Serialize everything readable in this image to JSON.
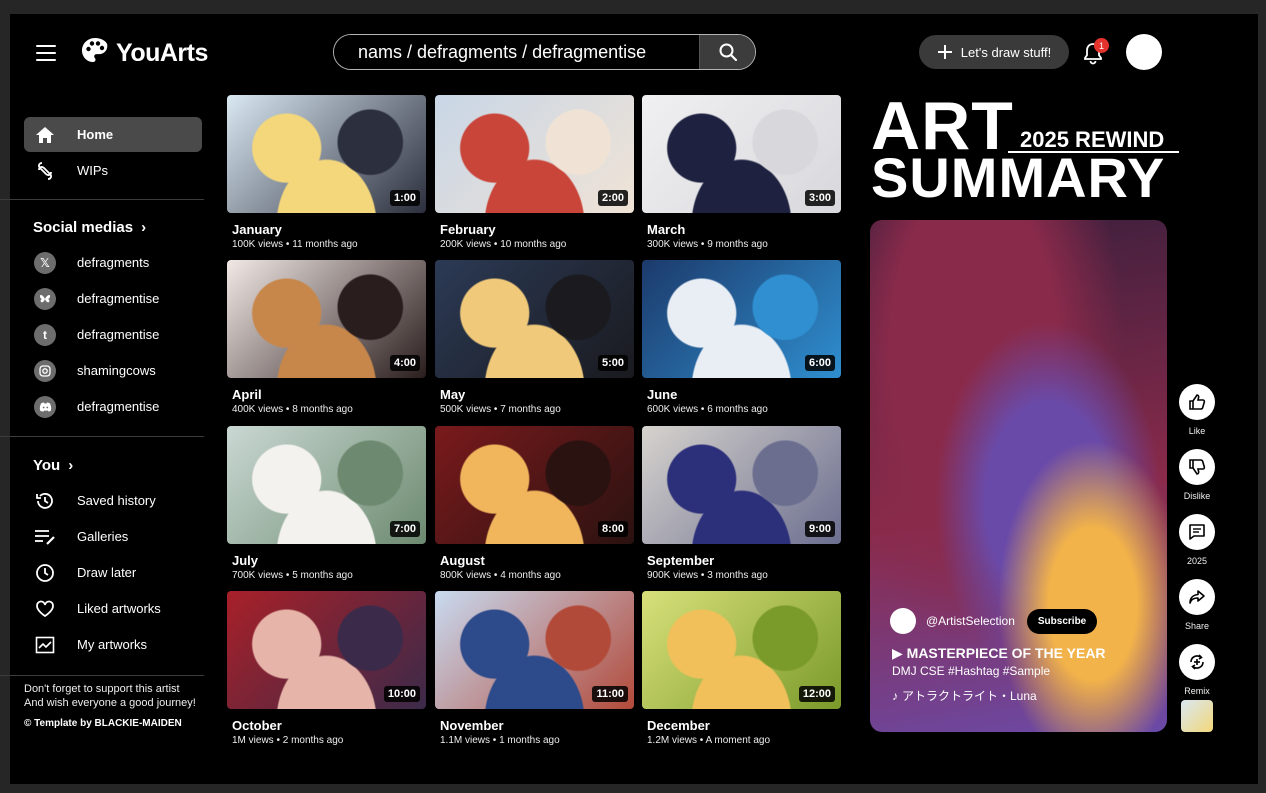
{
  "app": {
    "logo_text": "YouArts"
  },
  "search": {
    "value": "nams / defragments / defragmentise"
  },
  "header": {
    "draw_button_label": "Let's draw stuff!",
    "notification_count": "1"
  },
  "sidebar": {
    "main_items": [
      {
        "label": "Home",
        "icon": "home-icon",
        "active": true
      },
      {
        "label": "WIPs",
        "icon": "wips-icon",
        "active": false
      }
    ],
    "social_title": "Social medias",
    "socials": [
      {
        "label": "defragments",
        "icon": "x-icon"
      },
      {
        "label": "defragmentise",
        "icon": "bluesky-icon"
      },
      {
        "label": "defragmentise",
        "icon": "tumblr-icon"
      },
      {
        "label": "shamingcows",
        "icon": "instagram-icon"
      },
      {
        "label": "defragmentise",
        "icon": "discord-icon"
      }
    ],
    "you_title": "You",
    "you_items": [
      {
        "label": "Saved history",
        "icon": "history-icon"
      },
      {
        "label": "Galleries",
        "icon": "galleries-icon"
      },
      {
        "label": "Draw later",
        "icon": "clock-icon"
      },
      {
        "label": "Liked artworks",
        "icon": "heart-icon"
      },
      {
        "label": "My artworks",
        "icon": "chart-icon"
      }
    ],
    "footer_line1": "Don't forget to support this artist",
    "footer_line2": "And wish everyone a good journey!",
    "credit": "© Template by BLACKIE-MAIDEN"
  },
  "videos": [
    {
      "title": "January",
      "meta": "100K views • 11 months ago",
      "duration": "1:00",
      "colors": [
        "#d9e8f2",
        "#f3d77a",
        "#2c2f3d"
      ]
    },
    {
      "title": "February",
      "meta": "200K views • 10 months ago",
      "duration": "2:00",
      "colors": [
        "#c8d6e6",
        "#c9453a",
        "#f0e3d6"
      ]
    },
    {
      "title": "March",
      "meta": "300K views • 9 months ago",
      "duration": "3:00",
      "colors": [
        "#f0f0f2",
        "#1e2240",
        "#d8d8dc"
      ]
    },
    {
      "title": "April",
      "meta": "400K views • 8 months ago",
      "duration": "4:00",
      "colors": [
        "#f2e9e6",
        "#c8874a",
        "#2a1d1d"
      ]
    },
    {
      "title": "May",
      "meta": "500K views • 7 months ago",
      "duration": "5:00",
      "colors": [
        "#2b3a55",
        "#f0c97a",
        "#1a1a1f"
      ]
    },
    {
      "title": "June",
      "meta": "600K views • 6 months ago",
      "duration": "6:00",
      "colors": [
        "#1c3a6b",
        "#e9eef5",
        "#2f8fd0"
      ]
    },
    {
      "title": "July",
      "meta": "700K views • 5 months ago",
      "duration": "7:00",
      "colors": [
        "#c9d8d3",
        "#f4f2ee",
        "#6d8a70"
      ]
    },
    {
      "title": "August",
      "meta": "800K views • 4 months ago",
      "duration": "8:00",
      "colors": [
        "#7a1a1c",
        "#f1b65c",
        "#2a1210"
      ]
    },
    {
      "title": "September",
      "meta": "900K views • 3 months ago",
      "duration": "9:00",
      "colors": [
        "#d6d3cd",
        "#2c2f7a",
        "#6b6e8f"
      ]
    },
    {
      "title": "October",
      "meta": "1M views • 2 months ago",
      "duration": "10:00",
      "colors": [
        "#a82028",
        "#e6b4a8",
        "#3b2a4a"
      ]
    },
    {
      "title": "November",
      "meta": "1.1M views • 1 months ago",
      "duration": "11:00",
      "colors": [
        "#c8daf0",
        "#2d4a8a",
        "#b24a3a"
      ]
    },
    {
      "title": "December",
      "meta": "1.2M views • A moment ago",
      "duration": "12:00",
      "colors": [
        "#d8e07a",
        "#f2c05a",
        "#7a9a2a"
      ]
    }
  ],
  "rewind": {
    "art_word": "ART",
    "rewind_label": "2025 REWIND",
    "summary_word": "SUMMARY"
  },
  "short": {
    "channel": "@ArtistSelection",
    "subscribe_label": "Subscribe",
    "title": "▶ MASTERPIECE OF THE YEAR",
    "tags": "DMJ CSE #Hashtag #Sample",
    "song": "アトラクトライト・Luna",
    "colors": [
      "#3a1f3d",
      "#8a2a4a",
      "#6a4aa8",
      "#f2b34a"
    ]
  },
  "actions": [
    {
      "label": "Like",
      "icon": "thumbs-up-icon"
    },
    {
      "label": "Dislike",
      "icon": "thumbs-down-icon"
    },
    {
      "label": "2025",
      "icon": "comment-icon"
    },
    {
      "label": "Share",
      "icon": "share-icon"
    },
    {
      "label": "Remix",
      "icon": "remix-icon"
    }
  ]
}
